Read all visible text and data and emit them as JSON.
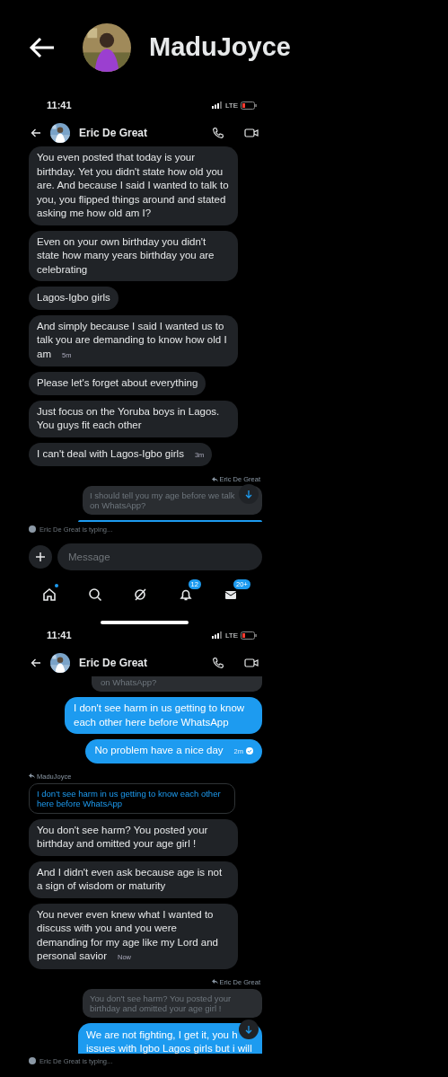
{
  "header": {
    "title": "MaduJoyce"
  },
  "screens": [
    {
      "status_time": "11:41",
      "network": "LTE",
      "contact": "Eric De Great",
      "messages": [
        {
          "kind": "received",
          "text": "You even posted that today is your birthday.  Yet you didn't state how old you are. And because I said I wanted to talk to you,  you flipped things around and stated asking me how old am I?"
        },
        {
          "kind": "received",
          "text": "Even on your own birthday you didn't state how many years birthday you are celebrating"
        },
        {
          "kind": "received",
          "text": "Lagos-Igbo girls"
        },
        {
          "kind": "received",
          "text": "And simply because I said I wanted us to talk you are demanding to know how old I am",
          "time": "5m"
        },
        {
          "kind": "received",
          "text": "Please let's forget about everything"
        },
        {
          "kind": "received",
          "text": "Just focus on the Yoruba boys in Lagos. You guys fit each other"
        },
        {
          "kind": "received",
          "text": "I can't deal with Lagos-Igbo girls",
          "time": "3m"
        },
        {
          "kind": "reply_label",
          "text": "Eric De Great"
        },
        {
          "kind": "quote",
          "text": "I should tell you my age before we talk on WhatsApp?"
        },
        {
          "kind": "sent_cut"
        }
      ],
      "typing": "Eric De Great is typing...",
      "composer": {
        "placeholder": "Message"
      },
      "nav": [
        {
          "kind": "home",
          "dot": true
        },
        {
          "kind": "search"
        },
        {
          "kind": "grok"
        },
        {
          "kind": "bell",
          "badge": "12"
        },
        {
          "kind": "mail",
          "badge": "20+"
        }
      ]
    },
    {
      "status_time": "11:41",
      "network": "LTE",
      "contact": "Eric De Great",
      "messages": [
        {
          "kind": "quote_cut",
          "text": "on WhatsApp?"
        },
        {
          "kind": "sent",
          "text": "I don't see harm in us getting to know each other here before WhatsApp"
        },
        {
          "kind": "sent",
          "text": "No problem have a nice day",
          "time": "2m",
          "read": true
        },
        {
          "kind": "reply_label_left",
          "text": "MaduJoyce"
        },
        {
          "kind": "quote_own",
          "text": "I don't see harm in us getting to know each other here before WhatsApp"
        },
        {
          "kind": "received",
          "text": "You don't see harm? You posted your birthday and omitted your age girl !"
        },
        {
          "kind": "received",
          "text": "And I didn't even ask because age is not a sign of wisdom or maturity"
        },
        {
          "kind": "received",
          "text": "You never even knew what I wanted to discuss with you and you were demanding for my age like my Lord and personal savior",
          "time": "Now"
        },
        {
          "kind": "reply_label",
          "text": "Eric De Great"
        },
        {
          "kind": "quote",
          "text": "You don't see harm? You posted your birthday and omitted your age girl !"
        },
        {
          "kind": "sent_lines",
          "lines": [
            "We are not fighting, I get it, you h",
            "issues with Igbo Lagos girls but i will"
          ]
        }
      ],
      "typing": "Eric De Great is typing..."
    }
  ]
}
